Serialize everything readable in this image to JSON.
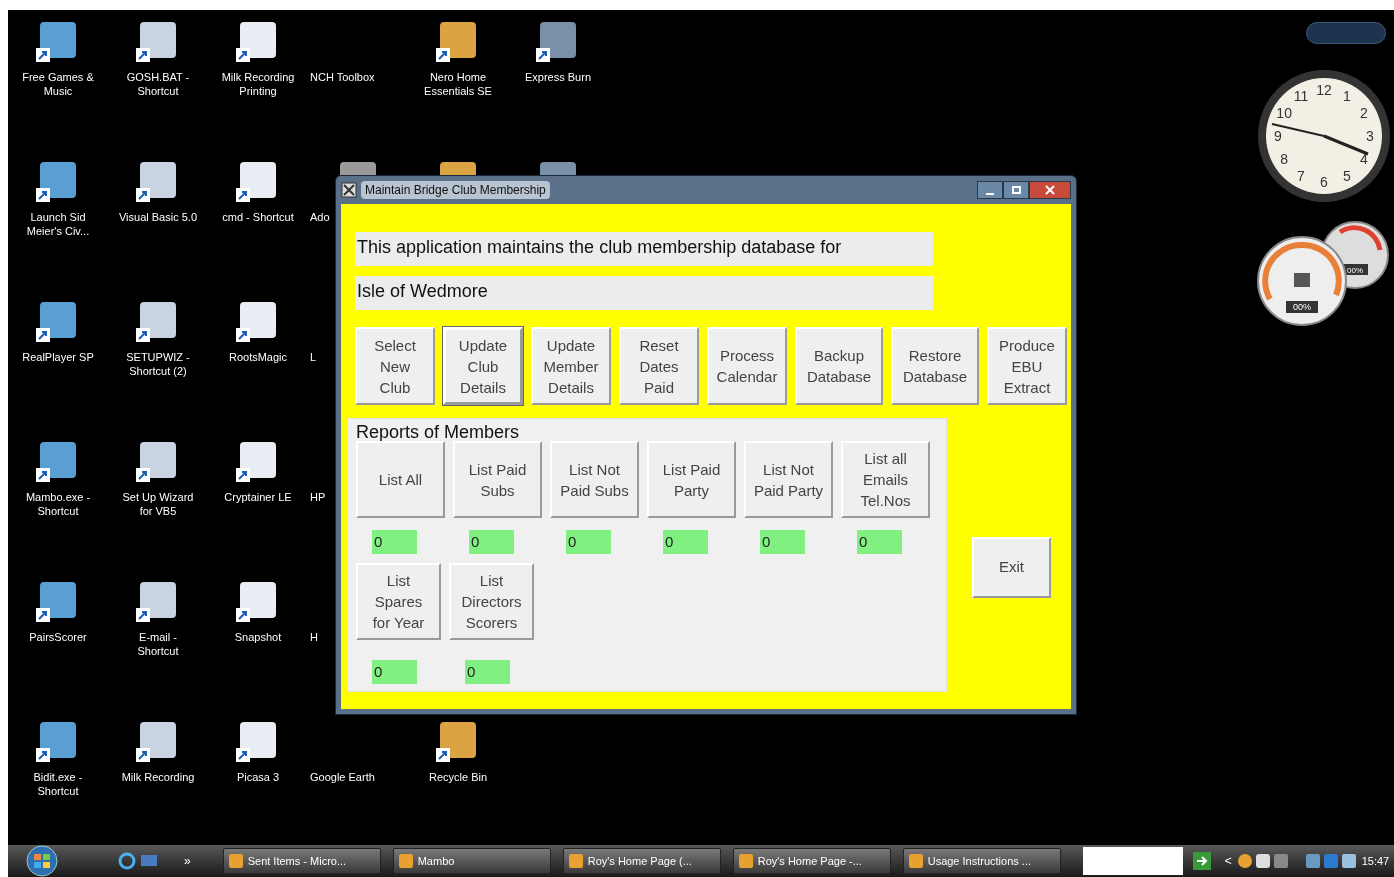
{
  "desktop_icons": [
    {
      "label": "Free Games &\nMusic"
    },
    {
      "label": "GOSH.BAT -\nShortcut"
    },
    {
      "label": "Milk Recording\nPrinting"
    },
    {
      "label": "NCH Toolbox"
    },
    {
      "label": "Nero Home\nEssentials SE"
    },
    {
      "label": "Express Burn"
    },
    {
      "label": "Launch Sid\nMeier's Civ..."
    },
    {
      "label": "Visual Basic 5.0"
    },
    {
      "label": "cmd - Shortcut"
    },
    {
      "label": "Ado"
    },
    {
      "label": "RealPlayer SP"
    },
    {
      "label": "SETUPWIZ -\nShortcut (2)"
    },
    {
      "label": "RootsMagic"
    },
    {
      "label": "L"
    },
    {
      "label": "Mambo.exe -\nShortcut"
    },
    {
      "label": "Set Up Wizard\nfor VB5"
    },
    {
      "label": "Cryptainer LE"
    },
    {
      "label": "HP"
    },
    {
      "label": "PairsScorer"
    },
    {
      "label": "E-mail -\nShortcut"
    },
    {
      "label": "Snapshot"
    },
    {
      "label": "H"
    },
    {
      "label": "Bidit.exe -\nShortcut"
    },
    {
      "label": "Milk Recording"
    },
    {
      "label": "Picasa 3"
    },
    {
      "label": "Google Earth"
    },
    {
      "label": "Recycle Bin"
    }
  ],
  "window": {
    "title": "Maintain Bridge Club Membership",
    "header_lines": [
      "This application maintains the club membership database for",
      "Isle of Wedmore"
    ],
    "buttons": [
      {
        "label": "Select\nNew\nClub",
        "focused": false
      },
      {
        "label": "Update\nClub\nDetails",
        "focused": true
      },
      {
        "label": "Update\nMember\nDetails",
        "focused": false
      },
      {
        "label": "Reset\nDates\nPaid",
        "focused": false
      },
      {
        "label": "Process\nCalendar",
        "focused": false
      },
      {
        "label": "Backup\nDatabase",
        "focused": false
      },
      {
        "label": "Restore\nDatabase",
        "focused": false
      },
      {
        "label": "Produce\nEBU\nExtract",
        "focused": false
      }
    ],
    "reports": {
      "title": "Reports of Members",
      "buttons": [
        {
          "label": "List All",
          "count": "0"
        },
        {
          "label": "List Paid\nSubs",
          "count": "0"
        },
        {
          "label": "List Not\nPaid Subs",
          "count": "0"
        },
        {
          "label": "List Paid\nParty",
          "count": "0"
        },
        {
          "label": "List Not\nPaid Party",
          "count": "0"
        },
        {
          "label": "List all\nEmails\nTel.Nos",
          "count": "0"
        },
        {
          "label": "List\nSpares\nfor Year",
          "count": "0"
        },
        {
          "label": "List\nDirectors\nScorers",
          "count": "0"
        }
      ]
    },
    "exit_button": "Exit"
  },
  "gadgets": {
    "clock_numbers": [
      "12",
      "1",
      "2",
      "3",
      "4",
      "5",
      "6",
      "7",
      "8",
      "9",
      "10",
      "11"
    ],
    "meter_readings": [
      "00%",
      "00%"
    ]
  },
  "taskbar": {
    "overflow": "»",
    "tasks": [
      {
        "label": "Sent Items - Micro..."
      },
      {
        "label": "Mambo"
      },
      {
        "label": "Roy's Home Page (..."
      },
      {
        "label": "Roy's Home Page -..."
      },
      {
        "label": "Usage Instructions ..."
      }
    ],
    "tray_arrow": "<",
    "time": "15:47"
  }
}
